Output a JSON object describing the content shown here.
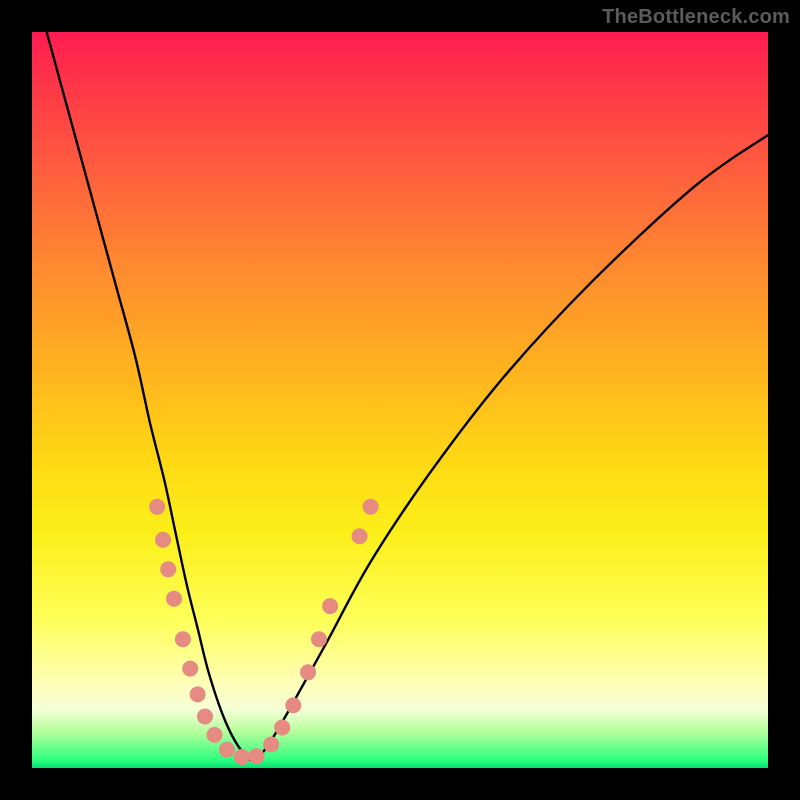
{
  "watermark": "TheBottleneck.com",
  "colors": {
    "frame": "#000000",
    "dot": "#e58b82",
    "curve": "#000000",
    "gradient_top": "#ff1b51",
    "gradient_bottom": "#07de70"
  },
  "chart_data": {
    "type": "line",
    "title": "",
    "xlabel": "",
    "ylabel": "",
    "xlim": [
      0,
      100
    ],
    "ylim": [
      0,
      100
    ],
    "grid": false,
    "legend": false,
    "series": [
      {
        "name": "bottleneck-curve",
        "x": [
          2,
          5,
          8,
          11,
          14,
          16,
          18,
          19.5,
          21,
          22.5,
          24,
          26,
          28,
          30,
          32,
          35,
          40,
          46,
          54,
          64,
          76,
          90,
          100
        ],
        "y": [
          100,
          89,
          78,
          67,
          56,
          47,
          39,
          32,
          25,
          19,
          13,
          7,
          3,
          1,
          3,
          8,
          17,
          28,
          40,
          53,
          66,
          79,
          86
        ]
      }
    ],
    "annotations": [],
    "dots": [
      {
        "x": 17.0,
        "y": 35.5
      },
      {
        "x": 17.8,
        "y": 31.0
      },
      {
        "x": 18.5,
        "y": 27.0
      },
      {
        "x": 19.3,
        "y": 23.0
      },
      {
        "x": 20.5,
        "y": 17.5
      },
      {
        "x": 21.5,
        "y": 13.5
      },
      {
        "x": 22.5,
        "y": 10.0
      },
      {
        "x": 23.5,
        "y": 7.0
      },
      {
        "x": 24.8,
        "y": 4.5
      },
      {
        "x": 26.5,
        "y": 2.5
      },
      {
        "x": 28.5,
        "y": 1.5
      },
      {
        "x": 30.5,
        "y": 1.6
      },
      {
        "x": 32.5,
        "y": 3.2
      },
      {
        "x": 34.0,
        "y": 5.5
      },
      {
        "x": 35.5,
        "y": 8.5
      },
      {
        "x": 37.5,
        "y": 13.0
      },
      {
        "x": 39.0,
        "y": 17.5
      },
      {
        "x": 40.5,
        "y": 22.0
      },
      {
        "x": 44.5,
        "y": 31.5
      },
      {
        "x": 46.0,
        "y": 35.5
      }
    ]
  }
}
